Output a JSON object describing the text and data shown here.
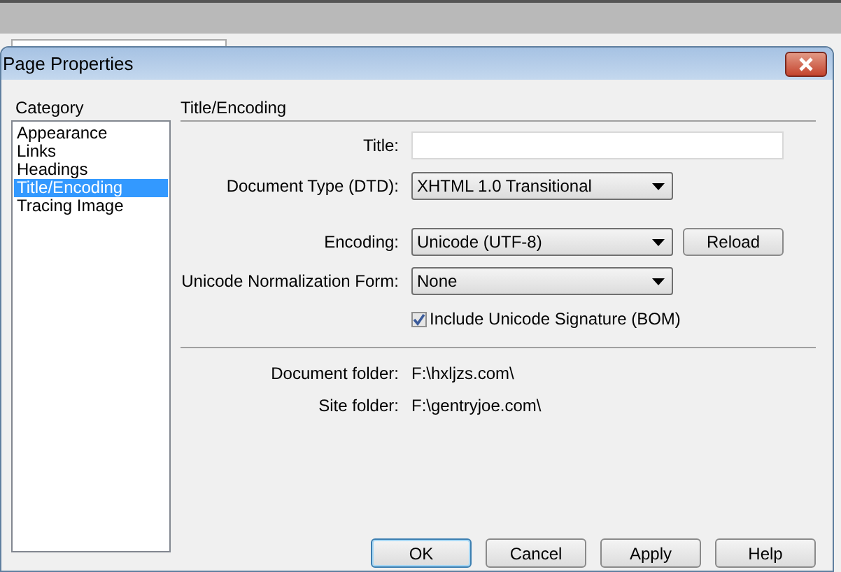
{
  "window": {
    "title": "Page Properties"
  },
  "category": {
    "label": "Category",
    "items": [
      {
        "label": "Appearance",
        "selected": false
      },
      {
        "label": "Links",
        "selected": false
      },
      {
        "label": "Headings",
        "selected": false
      },
      {
        "label": "Title/Encoding",
        "selected": true
      },
      {
        "label": "Tracing Image",
        "selected": false
      }
    ]
  },
  "panel": {
    "heading": "Title/Encoding",
    "fields": [
      {
        "kind": "text",
        "label": "Title:"
      },
      {
        "kind": "select",
        "label": "Document Type (DTD):",
        "value": "XHTML 1.0 Transitional"
      },
      {
        "kind": "select",
        "label": "Encoding:",
        "value": "Unicode (UTF-8)",
        "button": "Reload"
      },
      {
        "kind": "select",
        "label": "Unicode Normalization Form:",
        "value": "None"
      },
      {
        "kind": "checkbox",
        "label": "Include Unicode Signature (BOM)",
        "checked": true
      }
    ],
    "info": [
      {
        "label": "Document folder:",
        "value": "F:\\hxljzs.com\\"
      },
      {
        "label": "Site folder:",
        "value": "F:\\gentryjoe.com\\"
      }
    ]
  },
  "buttons": [
    {
      "label": "OK",
      "default": true
    },
    {
      "label": "Cancel",
      "default": false
    },
    {
      "label": "Apply",
      "default": false
    },
    {
      "label": "Help",
      "default": false
    }
  ]
}
